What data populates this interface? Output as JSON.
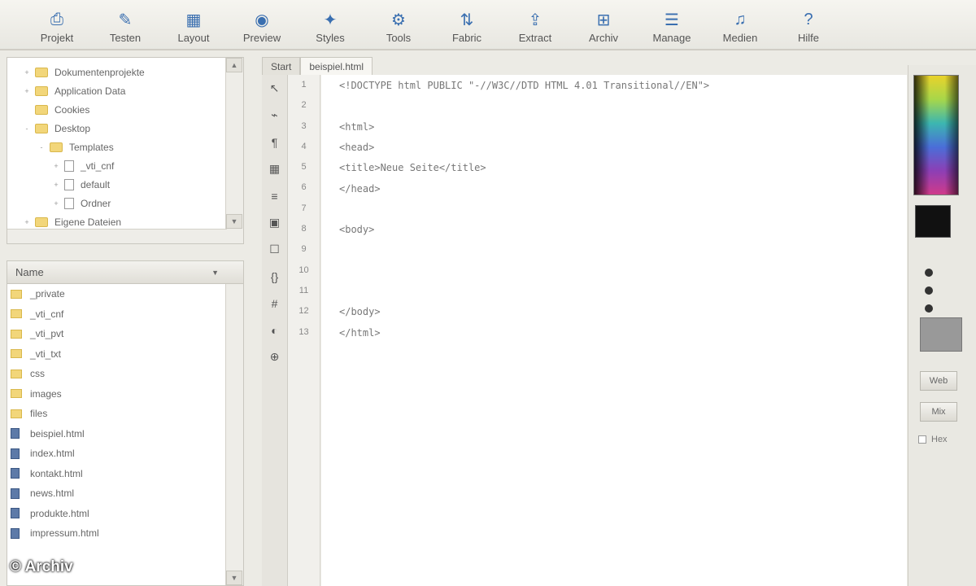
{
  "toolbar": {
    "items": [
      {
        "label": "Projekt",
        "icon": "project-icon"
      },
      {
        "label": "Testen",
        "icon": "test-icon"
      },
      {
        "label": "Layout",
        "icon": "layout-icon"
      },
      {
        "label": "Preview",
        "icon": "preview-icon"
      },
      {
        "label": "Styles",
        "icon": "styles-icon"
      },
      {
        "label": "Tools",
        "icon": "tools-icon"
      },
      {
        "label": "Fabric",
        "icon": "fabric-icon"
      },
      {
        "label": "Extract",
        "icon": "extract-icon"
      },
      {
        "label": "Archiv",
        "icon": "archive-icon"
      },
      {
        "label": "Manage",
        "icon": "manage-icon"
      },
      {
        "label": "Medien",
        "icon": "media-icon"
      },
      {
        "label": "Hilfe",
        "icon": "help-icon"
      }
    ]
  },
  "tree": {
    "items": [
      {
        "label": "Dokumentenprojekte",
        "kind": "folder",
        "indent": 1,
        "expander": "+"
      },
      {
        "label": "Application Data",
        "kind": "folder",
        "indent": 1,
        "expander": "+"
      },
      {
        "label": "Cookies",
        "kind": "folder",
        "indent": 1,
        "expander": ""
      },
      {
        "label": "Desktop",
        "kind": "folder",
        "indent": 1,
        "expander": "-"
      },
      {
        "label": "Templates",
        "kind": "folder",
        "indent": 2,
        "expander": "-"
      },
      {
        "label": "_vti_cnf",
        "kind": "file",
        "indent": 3,
        "expander": "+"
      },
      {
        "label": "default",
        "kind": "file",
        "indent": 3,
        "expander": "+"
      },
      {
        "label": "Ordner",
        "kind": "file",
        "indent": 3,
        "expander": "+"
      },
      {
        "label": "Eigene Dateien",
        "kind": "folder",
        "indent": 1,
        "expander": "+"
      }
    ]
  },
  "files": {
    "header": "Name",
    "items": [
      {
        "label": "_private",
        "kind": "folder"
      },
      {
        "label": "_vti_cnf",
        "kind": "folder"
      },
      {
        "label": "_vti_pvt",
        "kind": "folder"
      },
      {
        "label": "_vti_txt",
        "kind": "folder"
      },
      {
        "label": "css",
        "kind": "folder"
      },
      {
        "label": "images",
        "kind": "folder"
      },
      {
        "label": "files",
        "kind": "folder"
      },
      {
        "label": "beispiel.html",
        "kind": "doc"
      },
      {
        "label": "index.html",
        "kind": "doc"
      },
      {
        "label": "kontakt.html",
        "kind": "doc"
      },
      {
        "label": "news.html",
        "kind": "doc"
      },
      {
        "label": "produkte.html",
        "kind": "doc"
      },
      {
        "label": "impressum.html",
        "kind": "doc"
      }
    ]
  },
  "watermark": "© Archiv",
  "editor": {
    "tabs": [
      {
        "label": "Start",
        "active": false
      },
      {
        "label": "beispiel.html",
        "active": true
      }
    ],
    "gutter_icons": [
      "cursor-icon",
      "link-icon",
      "paragraph-icon",
      "table-icon",
      "list-icon",
      "image-icon",
      "form-icon",
      "script-icon",
      "style-icon",
      "color-icon",
      "zoom-icon"
    ],
    "line_numbers": [
      "1",
      "2",
      "3",
      "4",
      "5",
      "6",
      "7",
      "8",
      "9",
      "10",
      "11",
      "12",
      "13"
    ],
    "lines": [
      {
        "text": "<!DOCTYPE html PUBLIC \"-//W3C//DTD HTML 4.01 Transitional//EN\">",
        "row": 0
      },
      {
        "text": "<html>",
        "row": 2
      },
      {
        "text": "<head>",
        "row": 3
      },
      {
        "text": "    <title>Neue Seite</title>",
        "row": 4
      },
      {
        "text": "</head>",
        "row": 5
      },
      {
        "text": "<body>",
        "row": 7
      },
      {
        "text": "</body>",
        "row": 11
      },
      {
        "text": "</html>",
        "row": 12
      }
    ]
  },
  "palette": {
    "buttons": [
      "Web",
      "Mix"
    ],
    "current_color": "#111111",
    "option_label": "Hex"
  }
}
